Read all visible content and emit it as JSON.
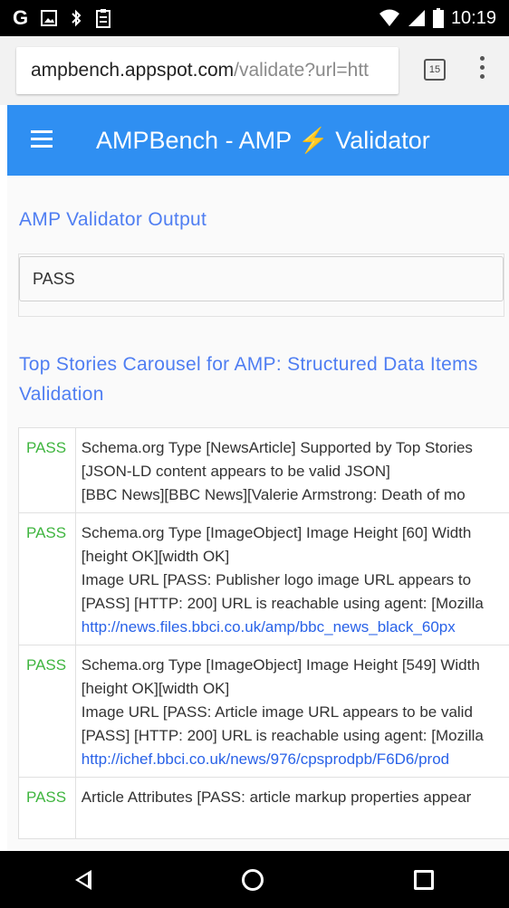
{
  "status_bar": {
    "time": "10:19",
    "left_icons": [
      "google-icon",
      "image-icon",
      "bluetooth-icon",
      "clipboard-icon"
    ],
    "right_icons": [
      "wifi-icon",
      "signal-icon",
      "battery-icon"
    ]
  },
  "browser": {
    "url_host": "ampbench.appspot.com",
    "url_path": "/validate?url=htt",
    "tab_count": "15"
  },
  "app_bar": {
    "title_before": "AMPBench - AMP ",
    "title_after": " Validator",
    "bolt_icon": "lightning-bolt-icon",
    "bolt_color": "#f7c21b",
    "color": "#2f8ff2"
  },
  "validator_output": {
    "heading": "AMP Validator Output",
    "value": "PASS"
  },
  "structured_data": {
    "heading": "Top Stories Carousel for AMP: Structured Data Items Validation",
    "rows": [
      {
        "status": "PASS",
        "lines": [
          "Schema.org Type [NewsArticle] Supported by Top Stories",
          "[JSON-LD content appears to be valid JSON]",
          "[BBC News][BBC News][Valerie Armstrong: Death of mo"
        ]
      },
      {
        "status": "PASS",
        "lines": [
          "Schema.org Type [ImageObject] Image Height [60] Width",
          "[height OK][width OK]",
          "Image URL [PASS: Publisher logo image URL appears to",
          "[PASS] [HTTP: 200] URL is reachable using agent: [Mozilla"
        ],
        "link": "http://news.files.bbci.co.uk/amp/bbc_news_black_60px"
      },
      {
        "status": "PASS",
        "lines": [
          "Schema.org Type [ImageObject] Image Height [549] Width",
          "[height OK][width OK]",
          "Image URL [PASS: Article image URL appears to be valid",
          "[PASS] [HTTP: 200] URL is reachable using agent: [Mozilla"
        ],
        "link": "http://ichef.bbci.co.uk/news/976/cpsprodpb/F6D6/prod"
      },
      {
        "status": "PASS",
        "lines": [
          "Article Attributes [PASS: article markup properties appear"
        ]
      }
    ],
    "pass_color": "#3fb53f",
    "link_color": "#2962e8"
  },
  "nav_bar": {
    "icons": [
      "back-icon",
      "home-icon",
      "recent-apps-icon"
    ]
  }
}
